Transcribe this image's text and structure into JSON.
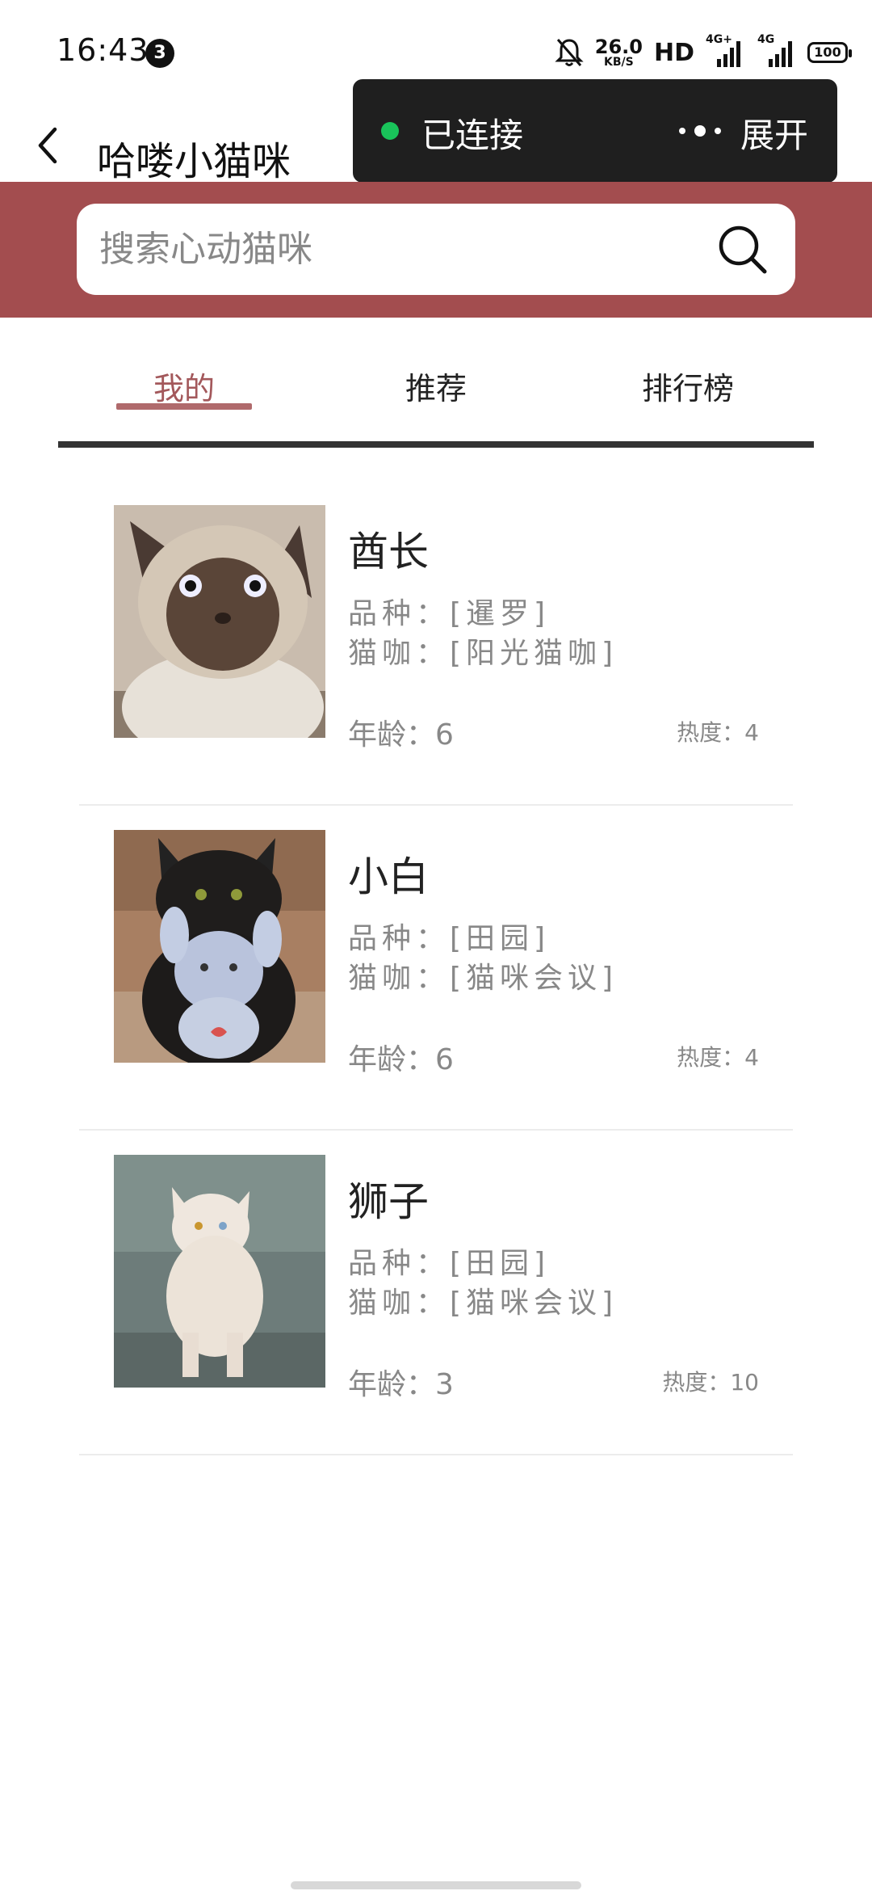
{
  "status_bar": {
    "time": "16:43",
    "notification_count": "3",
    "net_speed_value": "26.0",
    "net_speed_unit": "KB/S",
    "hd_label": "HD",
    "sim1_label": "4G+",
    "sim2_label": "4G",
    "battery": "100"
  },
  "header": {
    "title": "哈喽小猫咪",
    "capsule": {
      "status": "已连接",
      "expand": "展开",
      "status_color": "#19c35a"
    }
  },
  "search": {
    "placeholder": "搜索心动猫咪",
    "band_color": "#a34d4f"
  },
  "tabs": [
    {
      "label": "我的",
      "active": true
    },
    {
      "label": "推荐",
      "active": false
    },
    {
      "label": "排行榜",
      "active": false
    }
  ],
  "cats": [
    {
      "name": "酋长",
      "breed": "品种：[暹罗]",
      "cafe": "猫咖：[阳光猫咖]",
      "age": "年龄：6",
      "heat": "热度：4"
    },
    {
      "name": "小白",
      "breed": "品种：[田园]",
      "cafe": "猫咖：[猫咪会议]",
      "age": "年龄：6",
      "heat": "热度：4"
    },
    {
      "name": "狮子",
      "breed": "品种：[田园]",
      "cafe": "猫咖：[猫咪会议]",
      "age": "年龄：3",
      "heat": "热度：10"
    }
  ],
  "colors": {
    "accent": "#a3585b",
    "tab_active_underline": "#b06a6c"
  }
}
